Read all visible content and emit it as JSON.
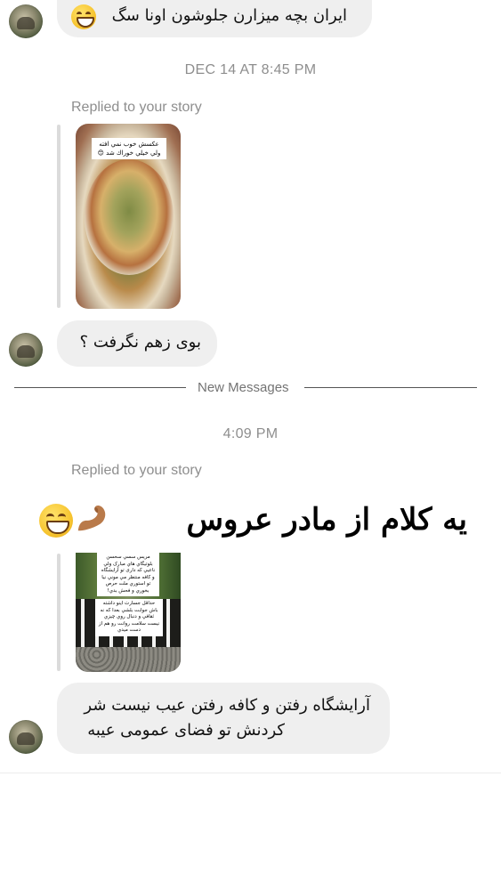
{
  "messages": {
    "top_partial": "ایران بچه میزارن جلوشون اونا  سگ",
    "timestamp_1": "DEC 14 AT 8:45 PM",
    "replied_1": "Replied to your story",
    "story_1_caption": "عکسش خوب نمي افته ولي خيلي خوراك شد 😊",
    "message_2": "بوی زهم نگرفت ؟",
    "new_messages": "New Messages",
    "timestamp_2": "4:09 PM",
    "replied_2": "Replied to your story",
    "overlay_text": "یه کلام از مادر عروس",
    "story_2_caption_top": "مريس سسي سحسن بلوتيگاي هاي مبارک ولي ناعيي که داری تو آرايشگاه و کافه منتظر مي موني نيا تو استوري ملت حرص بخوري و فحش بدي!",
    "story_2_caption_bottom": "حداقل جسارت اينو داشته باش جوابت بلشي بعدا كه نه ثقافي و دنبال روي چيزي نيست سلامت روانت رو هم از دست ميدي",
    "message_3_line1": "آرایشگاه رفتن و کافه رفتن عیب نیست شر",
    "message_3_line2": "کردنش تو فضای عمومی عیبه"
  },
  "icons": {
    "avatar": "user-avatar",
    "grin": "grinning-face-icon",
    "arm": "flexed-biceps-icon"
  },
  "colors": {
    "bubble": "#efefef",
    "timestamp": "#8e8e8e",
    "divider": "#555555"
  }
}
